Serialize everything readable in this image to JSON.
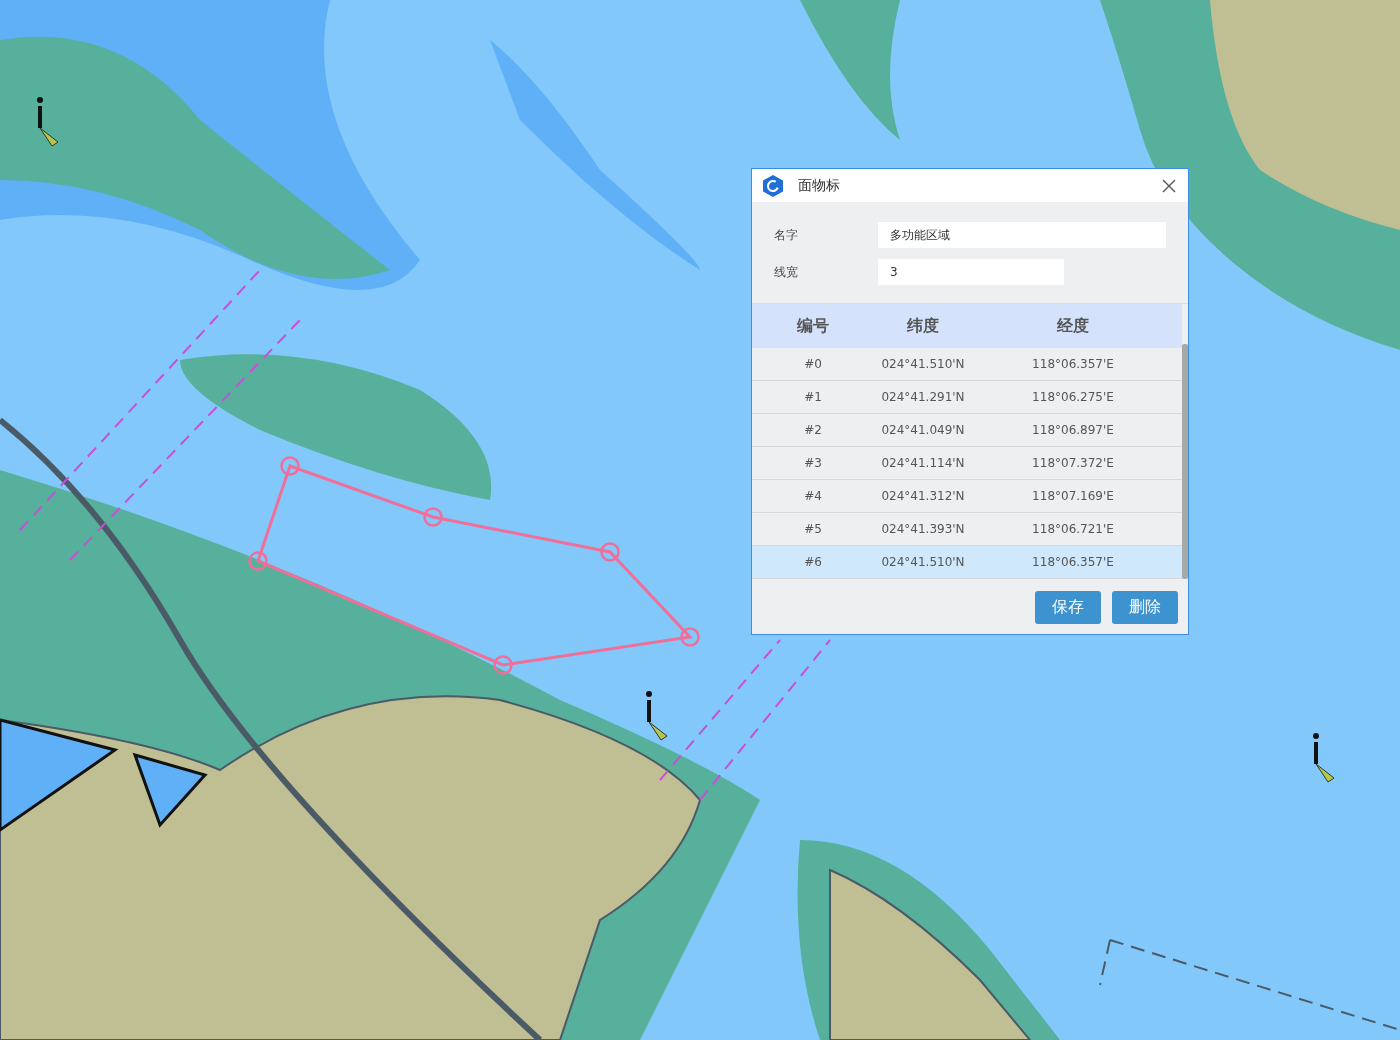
{
  "dialog": {
    "title": "面物标",
    "fields": [
      {
        "label": "名字",
        "value": "多功能区域",
        "kind": "wide"
      },
      {
        "label": "线宽",
        "value": "3",
        "kind": "narrow"
      }
    ],
    "table": {
      "columns": [
        "编号",
        "纬度",
        "经度"
      ],
      "rows": [
        {
          "cells": [
            "#0",
            "024°41.510'N",
            "118°06.357'E"
          ],
          "selected": false
        },
        {
          "cells": [
            "#1",
            "024°41.291'N",
            "118°06.275'E"
          ],
          "selected": false
        },
        {
          "cells": [
            "#2",
            "024°41.049'N",
            "118°06.897'E"
          ],
          "selected": false
        },
        {
          "cells": [
            "#3",
            "024°41.114'N",
            "118°07.372'E"
          ],
          "selected": false
        },
        {
          "cells": [
            "#4",
            "024°41.312'N",
            "118°07.169'E"
          ],
          "selected": false
        },
        {
          "cells": [
            "#5",
            "024°41.393'N",
            "118°06.721'E"
          ],
          "selected": false
        },
        {
          "cells": [
            "#6",
            "024°41.510'N",
            "118°06.357'E"
          ],
          "selected": true
        }
      ]
    },
    "buttons": [
      "保存",
      "删除"
    ]
  }
}
